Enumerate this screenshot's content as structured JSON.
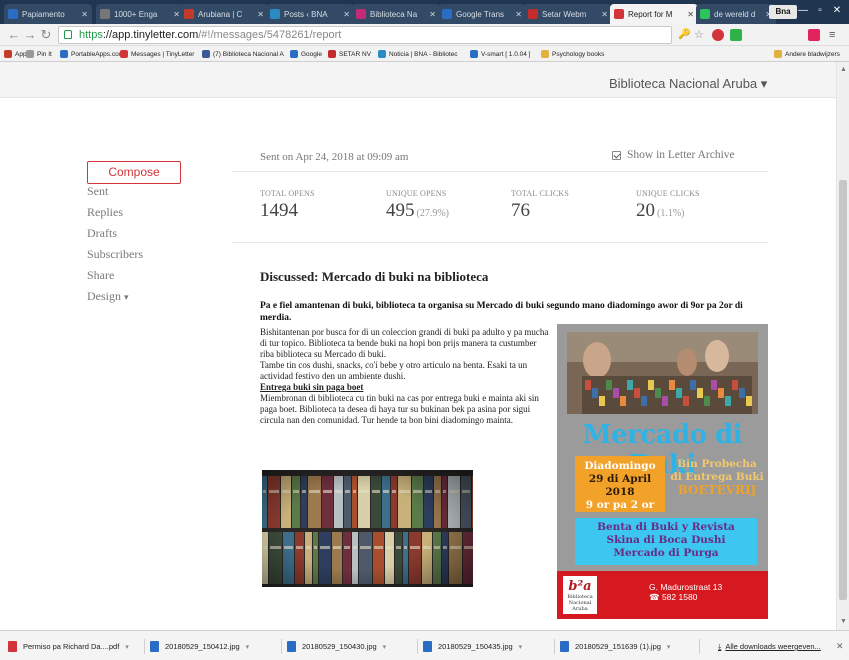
{
  "browser": {
    "tabs": [
      {
        "label": "Papiamento",
        "fav": "#2b6cc4"
      },
      {
        "label": "1000+ Enga",
        "fav": "#777777"
      },
      {
        "label": "Arubiana | C",
        "fav": "#c43a2b"
      },
      {
        "label": "Posts ‹ BNA",
        "fav": "#2b8bc4"
      },
      {
        "label": "Biblioteca Na",
        "fav": "#c42b76"
      },
      {
        "label": "Google Trans",
        "fav": "#2b6cc4"
      },
      {
        "label": "Setar Webm",
        "fav": "#c42b2b"
      },
      {
        "label": "Report for M",
        "fav": "#d2343a"
      },
      {
        "label": "de wereld d",
        "fav": "#2bc45a"
      }
    ],
    "user": "Bna",
    "url_scheme": "https",
    "url_host": "://app.tinyletter.com",
    "url_path": "/#!/messages/5478261/report",
    "bookmarks": [
      {
        "label": "Apps",
        "color": "#c43a2b"
      },
      {
        "label": "Pin It",
        "color": "#999999"
      },
      {
        "label": "PortableApps.com",
        "color": "#2b6cc4"
      },
      {
        "label": "Messages | TinyLetter",
        "color": "#d2343a"
      },
      {
        "label": "(7) Biblioteca Nacional A",
        "color": "#3b5998"
      },
      {
        "label": "Google",
        "color": "#2b6cc4"
      },
      {
        "label": "SETAR NV",
        "color": "#c42b2b"
      },
      {
        "label": "Noticia | BNA - Bibliotec",
        "color": "#2b8bc4"
      },
      {
        "label": "V-smart [ 1.0.04 ]",
        "color": "#2b6cc4"
      },
      {
        "label": "Psychology books",
        "color": "#e0b040"
      }
    ],
    "other_bookmarks": "Andere bladwijzers"
  },
  "header": {
    "account_name": "Biblioteca Nacional Aruba"
  },
  "sidebar": {
    "compose": "Compose",
    "items": [
      {
        "label": "Sent"
      },
      {
        "label": "Replies"
      },
      {
        "label": "Drafts"
      },
      {
        "label": "Subscribers"
      },
      {
        "label": "Share"
      },
      {
        "label": "Design"
      }
    ]
  },
  "report": {
    "sent_on": "Sent on Apr 24, 2018 at 09:09 am",
    "show_archive": "Show in Letter Archive",
    "stats": [
      {
        "label": "TOTAL OPENS",
        "value": "1494",
        "pct": ""
      },
      {
        "label": "UNIQUE OPENS",
        "value": "495",
        "pct": "(27.9%)"
      },
      {
        "label": "TOTAL CLICKS",
        "value": "76",
        "pct": ""
      },
      {
        "label": "UNIQUE CLICKS",
        "value": "20",
        "pct": "(1.1%)"
      }
    ],
    "discussed": "Discussed: Mercado di buki na biblioteca",
    "intro": "Pa e fiel amantenan di buki, biblioteca ta organisa su Mercado di buki segundo mano diadomingo awor di 9or pa 2or di merdia.",
    "p1": "Bishitantenan por busca for di un coleccion grandi di buki pa adulto y pa mucha di tur topico. Biblioteca ta bende buki na hopi bon prijs manera ta custumber riba biblioteca su Mercado di buki.",
    "p2": "Tambe tin cos dushi, snacks, co'i bebe y otro articulo na benta. Esaki ta un actividad festivo den un ambiente dushi.",
    "heading": "Entrega buki sin paga boet",
    "p3": "Miembronan di biblioteca cu tin buki na cas por entrega buki e mainta aki sin paga boet. Biblioteca ta desea di haya tur su bukinan bek pa asina por sigui circula nan den comunidad. Tur hende ta bon bini diadomingo mainta."
  },
  "poster": {
    "title": "Mercado di Buki",
    "left": [
      "Diadomingo",
      "29 di April 2018",
      "9 or pa 2 or"
    ],
    "right": [
      "Bin Probecha",
      "di Entrega Buki",
      "BOETEVRIJ"
    ],
    "sale": [
      "Benta di Buki y Revista",
      "Skina di Boca Dushi",
      "Mercado di Purga"
    ],
    "logo": "Biblioteca Nacional Aruba",
    "logo_mark": "b²a",
    "address": "G. Madurostraat 13",
    "phone": "☎ 582 1580"
  },
  "downloads": {
    "items": [
      {
        "name": "Permiso pa Richard Da....pdf",
        "color": "#d2343a"
      },
      {
        "name": "20180529_150412.jpg",
        "color": "#2b6cc4"
      },
      {
        "name": "20180529_150430.jpg",
        "color": "#2b6cc4"
      },
      {
        "name": "20180529_150435.jpg",
        "color": "#2b6cc4"
      },
      {
        "name": "20180529_151639 (1).jpg",
        "color": "#2b6cc4"
      }
    ],
    "show_all": "Alle downloads weergeven..."
  }
}
